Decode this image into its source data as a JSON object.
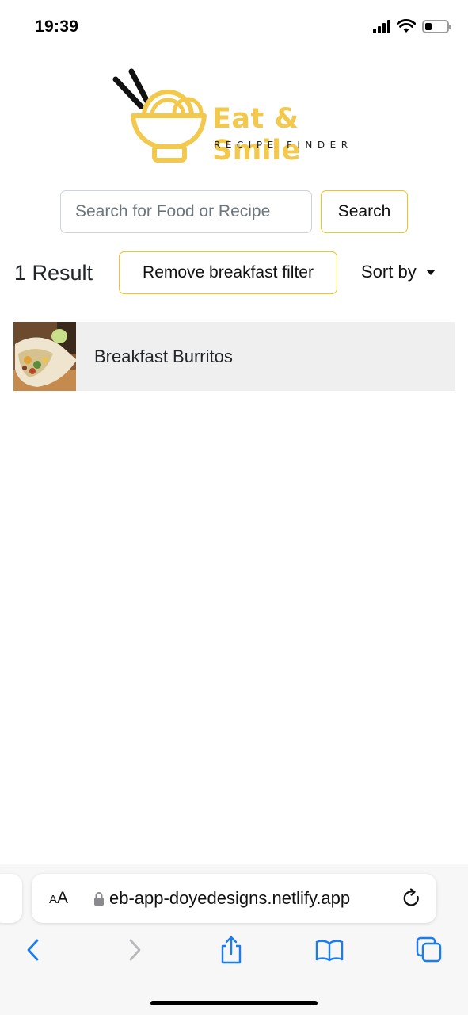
{
  "status_bar": {
    "time": "19:39"
  },
  "logo": {
    "title": "Eat & Smile",
    "subtitle": "RECIPE FINDER",
    "brand_color": "#f2c94c"
  },
  "search": {
    "placeholder": "Search for Food or Recipe",
    "value": "",
    "button_label": "Search"
  },
  "results": {
    "count_label": "1 Result",
    "filter_button_label": "Remove breakfast filter",
    "sort_label": "Sort by"
  },
  "recipes": [
    {
      "title": "Breakfast Burritos"
    }
  ],
  "browser": {
    "text_size_label_small": "A",
    "text_size_label_large": "A",
    "url": "eb-app-doyedesigns.netlify.app",
    "accent_color": "#1a7bf2"
  }
}
